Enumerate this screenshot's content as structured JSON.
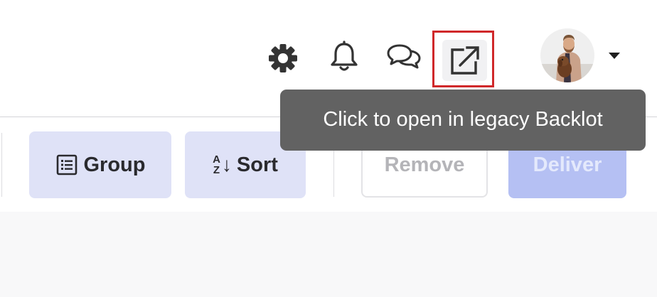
{
  "header": {
    "icons": {
      "settings": "gear-icon",
      "notifications": "bell-icon",
      "chat": "chat-bubbles-icon",
      "open_legacy": "external-link-icon",
      "account_menu": "chevron-down-icon"
    }
  },
  "tooltip": {
    "text": "Click to open in legacy Backlot"
  },
  "toolbar": {
    "group_label": "Group",
    "sort_label": "Sort",
    "sort_glyph_top": "A",
    "sort_glyph_bottom": "Z",
    "sort_arrow": "↓",
    "remove_label": "Remove",
    "deliver_label": "Deliver"
  },
  "colors": {
    "highlight": "#d0282a",
    "tooltip_bg": "#626262",
    "secondary_button_bg": "#dfe2f7",
    "primary_button_disabled_bg": "#b5c0f3"
  }
}
